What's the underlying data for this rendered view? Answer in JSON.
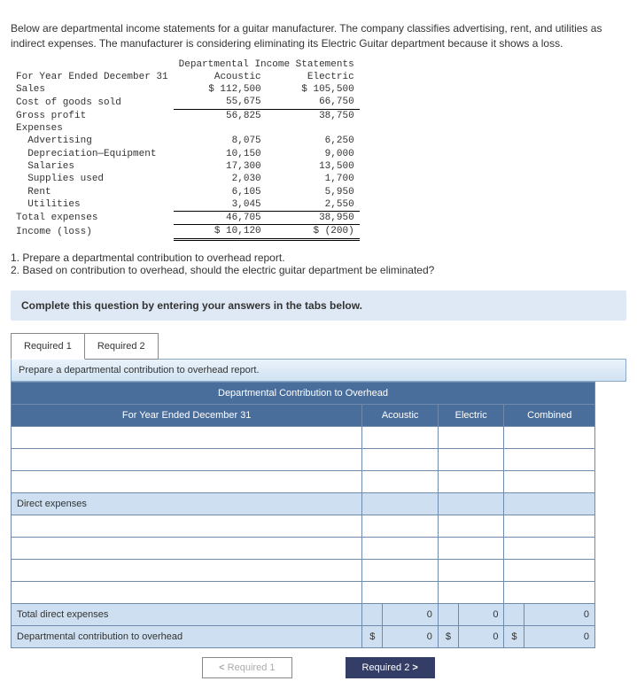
{
  "intro": "Below are departmental income statements for a guitar manufacturer. The company classifies advertising, rent, and utilities as indirect expenses. The manufacturer is considering eliminating its Electric Guitar department because it shows a loss.",
  "stmt": {
    "title": "Departmental Income Statements",
    "period": "For Year Ended December 31",
    "cols": {
      "a": "Acoustic",
      "e": "Electric"
    },
    "rows": {
      "sales": {
        "label": "Sales",
        "a": "$ 112,500",
        "e": "$ 105,500"
      },
      "cogs": {
        "label": "Cost of goods sold",
        "a": "55,675",
        "e": "66,750"
      },
      "gp": {
        "label": "Gross profit",
        "a": "56,825",
        "e": "38,750"
      },
      "exp": {
        "label": "Expenses"
      },
      "adv": {
        "label": "  Advertising",
        "a": "8,075",
        "e": "6,250"
      },
      "dep": {
        "label": "  Depreciation—Equipment",
        "a": "10,150",
        "e": "9,000"
      },
      "sal": {
        "label": "  Salaries",
        "a": "17,300",
        "e": "13,500"
      },
      "sup": {
        "label": "  Supplies used",
        "a": "2,030",
        "e": "1,700"
      },
      "rent": {
        "label": "  Rent",
        "a": "6,105",
        "e": "5,950"
      },
      "util": {
        "label": "  Utilities",
        "a": "3,045",
        "e": "2,550"
      },
      "tot": {
        "label": "Total expenses",
        "a": "46,705",
        "e": "38,950"
      },
      "inc": {
        "label": "Income (loss)",
        "a": "$ 10,120",
        "e": "$ (200)"
      }
    }
  },
  "questions": {
    "q1": "1. Prepare a departmental contribution to overhead report.",
    "q2": "2. Based on contribution to overhead, should the electric guitar department be eliminated?"
  },
  "banner": "Complete this question by entering your answers in the tabs below.",
  "tabs": {
    "r1": "Required 1",
    "r2": "Required 2"
  },
  "panel": {
    "instruction": "Prepare a departmental contribution to overhead report.",
    "title": "Departmental Contribution to Overhead",
    "headers": {
      "period": "For Year Ended December 31",
      "a": "Acoustic",
      "e": "Electric",
      "c": "Combined"
    },
    "rows": {
      "direct": "Direct expenses",
      "totdirect": "  Total direct expenses",
      "contrib": "Departmental contribution to overhead"
    },
    "vals": {
      "zero": "0",
      "sym": "$"
    }
  },
  "nav": {
    "prev": "Required 1",
    "next": "Required 2"
  }
}
